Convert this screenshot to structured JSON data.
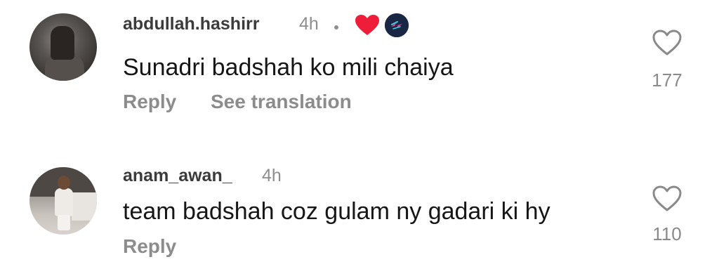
{
  "comments": [
    {
      "username": "abdullah.hashirr",
      "time": "4h",
      "text": "Sunadri badshah ko mili chaiya",
      "reply_label": "Reply",
      "translate_label": "See translation",
      "likes": "177",
      "reaction_icons": [
        "red-heart-icon",
        "creator-badge-icon"
      ]
    },
    {
      "username": "anam_awan_",
      "time": "4h",
      "text": "team badshah coz gulam ny gadari ki hy",
      "reply_label": "Reply",
      "likes": "110"
    }
  ],
  "colors": {
    "username": "#3b3b3b",
    "meta": "#8e8e8e",
    "text": "#161616",
    "heart_red": "#ee1d3a",
    "badge_bg": "#1a2744"
  }
}
